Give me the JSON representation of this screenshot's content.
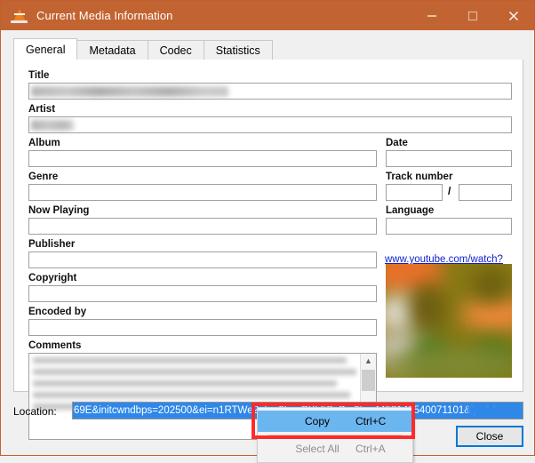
{
  "window": {
    "title": "Current Media Information",
    "icon": "vlc-cone-icon",
    "titlebar_color": "#c26432",
    "controls": {
      "minimize": "minimize-icon",
      "maximize": "maximize-icon",
      "close": "close-icon"
    }
  },
  "tabs": [
    {
      "label": "General",
      "active": true
    },
    {
      "label": "Metadata",
      "active": false
    },
    {
      "label": "Codec",
      "active": false
    },
    {
      "label": "Statistics",
      "active": false
    }
  ],
  "form": {
    "title": {
      "label": "Title",
      "value": "",
      "redacted": true
    },
    "artist": {
      "label": "Artist",
      "value": "",
      "redacted": true
    },
    "album": {
      "label": "Album",
      "value": ""
    },
    "genre": {
      "label": "Genre",
      "value": ""
    },
    "now_playing": {
      "label": "Now Playing",
      "value": ""
    },
    "publisher": {
      "label": "Publisher",
      "value": ""
    },
    "copyright": {
      "label": "Copyright",
      "value": ""
    },
    "encoded_by": {
      "label": "Encoded by",
      "value": ""
    },
    "comments": {
      "label": "Comments",
      "value": "",
      "redacted": true
    },
    "date": {
      "label": "Date",
      "value": ""
    },
    "track_number": {
      "label": "Track number",
      "value": "",
      "separator": "/",
      "total_value": ""
    },
    "language": {
      "label": "Language",
      "value": ""
    },
    "url_link": "www.youtube.com/watch?"
  },
  "artwork": {
    "name": "album-art-thumbnail",
    "blurred": true,
    "colors": [
      "#8a7a16",
      "#e8722a",
      "#4d7a22",
      "#d6d2c4"
    ]
  },
  "location": {
    "label": "Location:",
    "value": "69E&initcwndbps=202500&ei=n1RTWe2gL...9Li...CXL5S..B...9h...4458142540071101&ip=14.",
    "selected": true,
    "selection_color": "#2f88e8"
  },
  "context_menu": {
    "items": [
      {
        "label": "Copy",
        "shortcut": "Ctrl+C",
        "highlighted": true,
        "disabled": false
      },
      {
        "label": "Select All",
        "shortcut": "Ctrl+A",
        "highlighted": false,
        "disabled": true
      }
    ]
  },
  "buttons": {
    "close": "Close"
  },
  "annotation": {
    "type": "rectangle-highlight",
    "color": "#ff2a2a",
    "target": "Copy"
  }
}
